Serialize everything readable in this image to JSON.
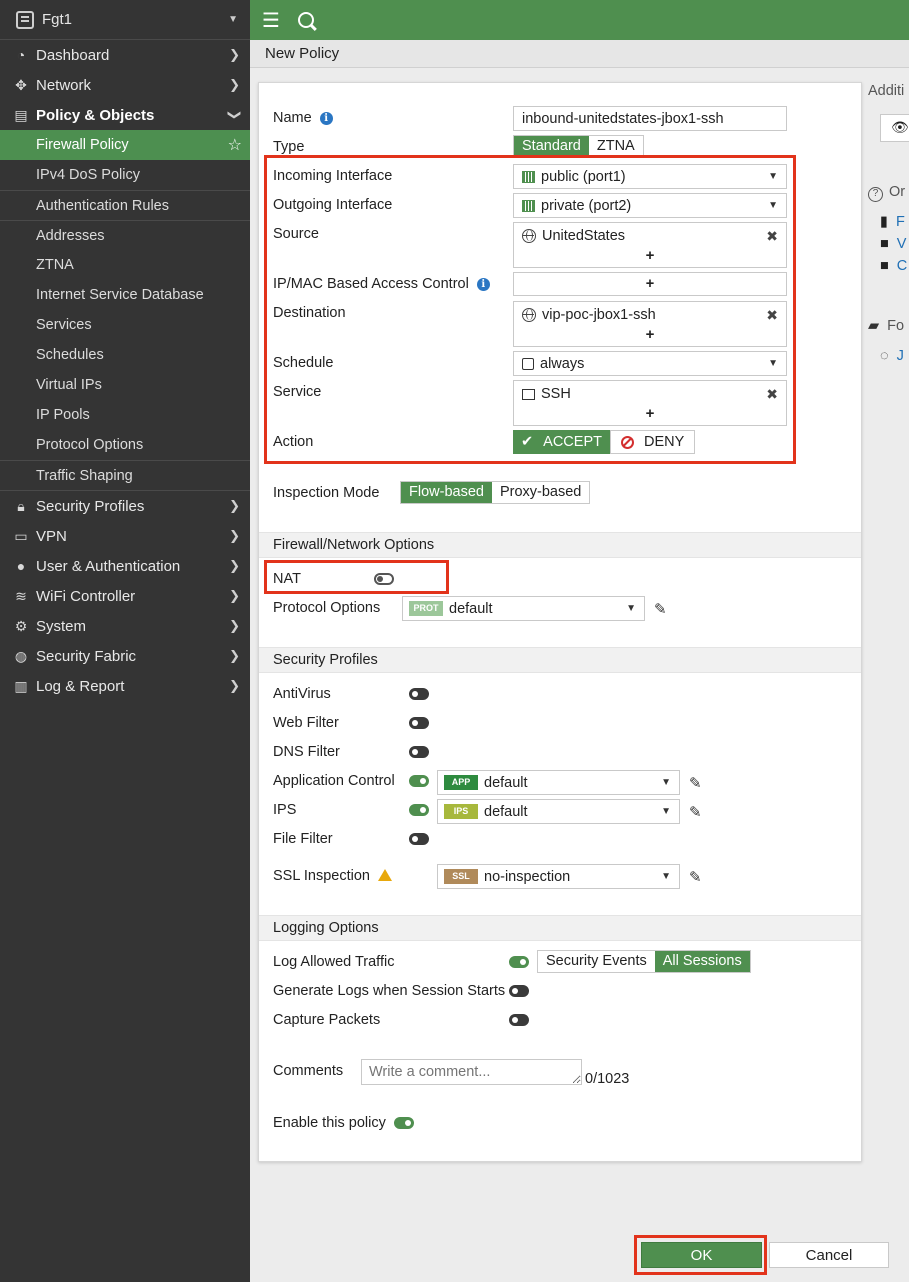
{
  "app": {
    "device_name": "Fgt1"
  },
  "sidebar": {
    "top_items": [
      {
        "label": "Dashboard"
      },
      {
        "label": "Network"
      },
      {
        "label": "Policy & Objects"
      }
    ],
    "sub_items": [
      "Firewall Policy",
      "IPv4 DoS Policy",
      "Authentication Rules",
      "Addresses",
      "ZTNA",
      "Internet Service Database",
      "Services",
      "Schedules",
      "Virtual IPs",
      "IP Pools",
      "Protocol Options",
      "Traffic Shaping"
    ],
    "bottom_items": [
      "Security Profiles",
      "VPN",
      "User & Authentication",
      "WiFi Controller",
      "System",
      "Security Fabric",
      "Log & Report"
    ]
  },
  "breadcrumb": {
    "title": "New Policy"
  },
  "form": {
    "name_label": "Name",
    "name_value": "inbound-unitedstates-jbox1-ssh",
    "type_label": "Type",
    "type_options": [
      "Standard",
      "ZTNA"
    ],
    "incoming_label": "Incoming Interface",
    "incoming_value": "public (port1)",
    "outgoing_label": "Outgoing Interface",
    "outgoing_value": "private (port2)",
    "source_label": "Source",
    "source_value": "UnitedStates",
    "ipmac_label": "IP/MAC Based Access Control",
    "destination_label": "Destination",
    "destination_value": "vip-poc-jbox1-ssh",
    "schedule_label": "Schedule",
    "schedule_value": "always",
    "service_label": "Service",
    "service_value": "SSH",
    "action_label": "Action",
    "action_accept": "ACCEPT",
    "action_deny": "DENY",
    "plus": "+",
    "inspection_label": "Inspection Mode",
    "inspection_options": [
      "Flow-based",
      "Proxy-based"
    ],
    "fw_section": "Firewall/Network Options",
    "nat_label": "NAT",
    "protocol_label": "Protocol Options",
    "protocol_tag": "PROT",
    "protocol_value": "default",
    "sec_section": "Security Profiles",
    "antivirus": "AntiVirus",
    "webfilter": "Web Filter",
    "dnsfilter": "DNS Filter",
    "appcontrol": "Application Control",
    "app_tag": "APP",
    "app_value": "default",
    "ips": "IPS",
    "ips_tag": "IPS",
    "ips_value": "default",
    "filefilter": "File Filter",
    "ssl": "SSL Inspection",
    "ssl_tag": "SSL",
    "ssl_value": "no-inspection",
    "log_section": "Logging Options",
    "log_allowed": "Log Allowed Traffic",
    "log_options": [
      "Security Events",
      "All Sessions"
    ],
    "gen_logs": "Generate Logs when Session Starts",
    "capture": "Capture Packets",
    "comments_label": "Comments",
    "comments_placeholder": "Write a comment...",
    "comments_count": "0/1023",
    "enable_label": "Enable this policy"
  },
  "right_strip": {
    "additional": "Additi",
    "online": "Or",
    "feedback": "Fo",
    "link_r": "F",
    "link_v": "V",
    "link_c": "C",
    "chat": "J"
  },
  "buttons": {
    "ok": "OK",
    "cancel": "Cancel"
  },
  "colors": {
    "accent": "#4f8f4f",
    "sidebar": "#343434",
    "highlight": "#e2331b"
  }
}
